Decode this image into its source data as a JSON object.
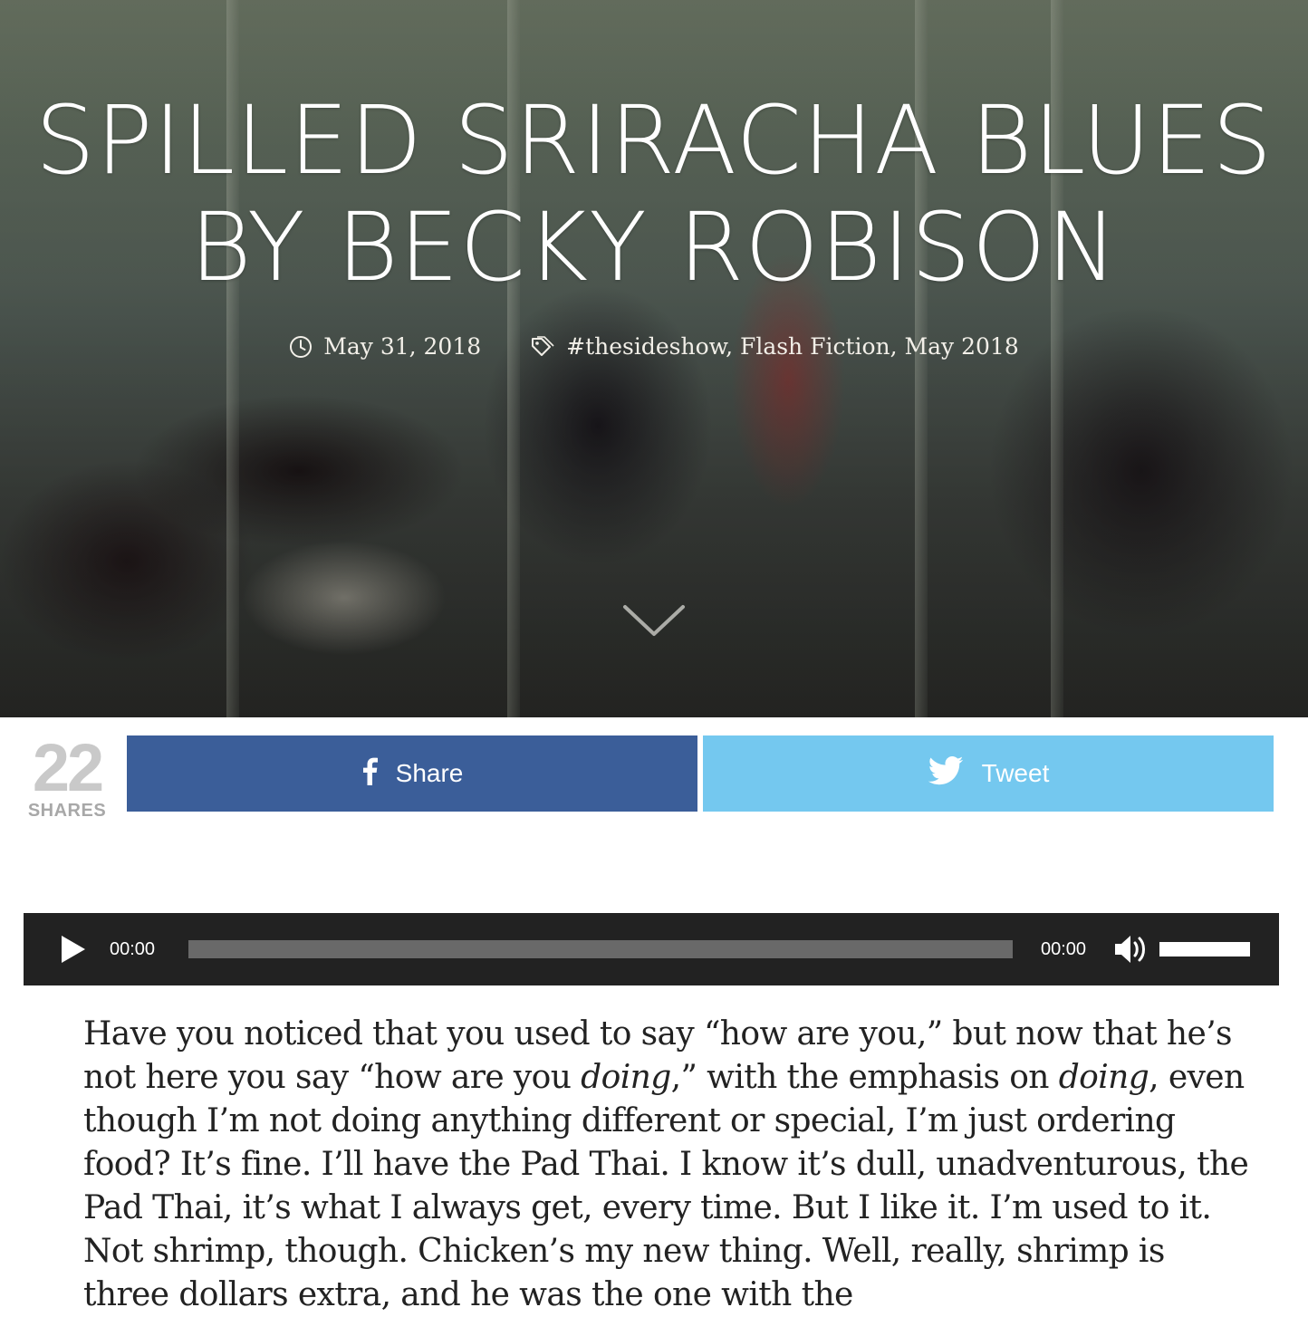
{
  "hero": {
    "title_line1": "Spilled Sriracha Blues",
    "title_line2": "by Becky Robison",
    "date": "May 31, 2018",
    "categories": "#thesideshow, Flash Fiction, May 2018",
    "icons": {
      "date": "clock-icon",
      "categories": "tag-icon",
      "scroll": "chevron-down-icon"
    }
  },
  "share": {
    "count": "22",
    "count_label": "SHARES",
    "facebook_label": "Share",
    "twitter_label": "Tweet",
    "colors": {
      "facebook": "#3b5e99",
      "twitter": "#74c8ef"
    }
  },
  "player": {
    "current_time": "00:00",
    "duration": "00:00",
    "progress": 0,
    "volume": 1.0,
    "icons": {
      "play": "play-icon",
      "mute": "speaker-icon"
    }
  },
  "article": {
    "p1_a": "Have you noticed that you used to say “how are you,” but now that he’s not here you say “how are you ",
    "p1_em1": "doing",
    "p1_b": ",” with the emphasis on ",
    "p1_em2": "doing",
    "p1_c": ", even though I’m not doing anything different or special, I’m just ordering food? It’s fine. I’ll have the Pad Thai. I know it’s dull, unadventurous, the Pad Thai, it’s what I always get, every time. But I like it. I’m used to it. Not shrimp, though. Chicken’s my new thing. Well, really, shrimp is three dollars extra, and he was the one with the"
  }
}
